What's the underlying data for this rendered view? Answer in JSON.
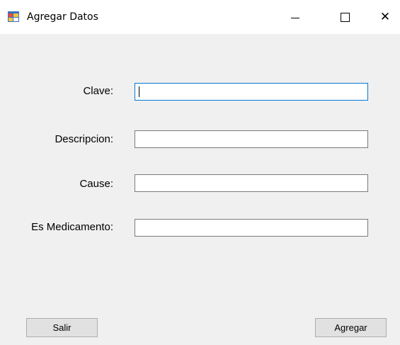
{
  "window": {
    "title": "Agregar Datos",
    "icons": {
      "app": "form-app-icon",
      "minimize": "minimize-icon",
      "maximize": "maximize-icon",
      "close": "close-icon"
    },
    "close_glyph": "✕"
  },
  "form": {
    "clave_label": "Clave:",
    "clave_value": "",
    "descripcion_label": "Descripcion:",
    "descripcion_value": "",
    "cause_label": "Cause:",
    "cause_value": "",
    "medicamento_label": "Es Medicamento:",
    "medicamento_value": ""
  },
  "buttons": {
    "salir_label": "Salir",
    "agregar_label": "Agregar"
  },
  "colors": {
    "focus_border": "#0078d7",
    "background": "#f0f0f0"
  }
}
